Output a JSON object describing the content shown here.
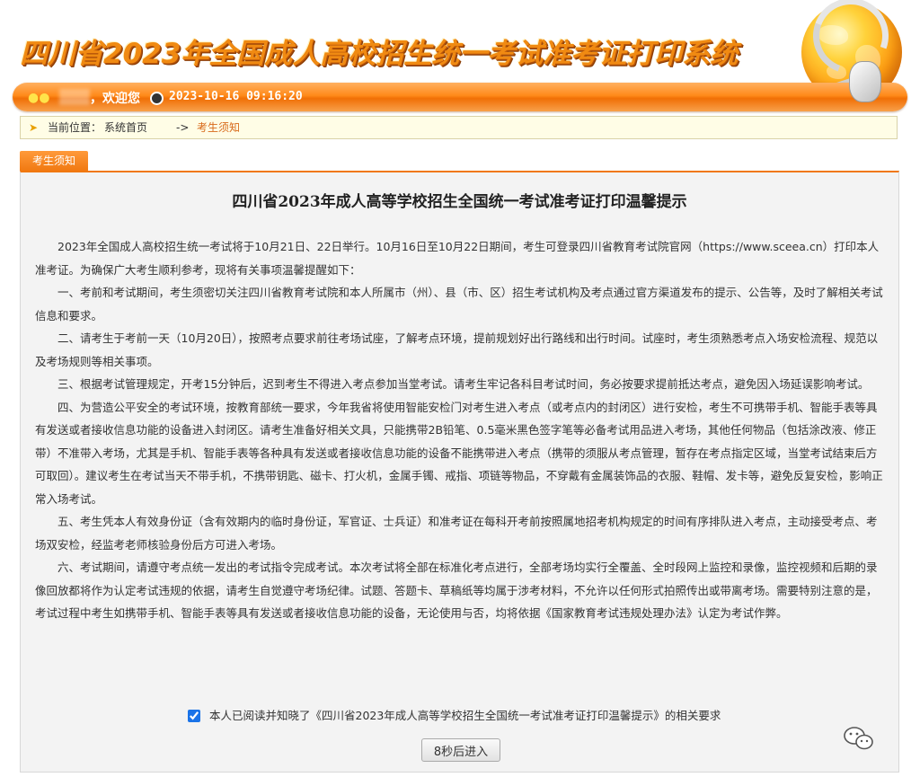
{
  "header": {
    "site_title": "四川省2023年全国成人高校招生统一考试准考证打印系统",
    "welcome": "，欢迎您",
    "datetime": "2023-10-16 09:16:20"
  },
  "breadcrumb": {
    "label": "当前位置：",
    "home": "系统首页",
    "separator": "->",
    "current": "考生须知"
  },
  "tab": {
    "label": "考生须知"
  },
  "notice": {
    "title": "四川省2023年成人高等学校招生全国统一考试准考证打印温馨提示",
    "paragraphs": [
      "2023年全国成人高校招生统一考试将于10月21日、22日举行。10月16日至10月22日期间，考生可登录四川省教育考试院官网（https://www.sceea.cn）打印本人准考证。为确保广大考生顺利参考，现将有关事项温馨提醒如下：",
      "一、考前和考试期间，考生须密切关注四川省教育考试院和本人所属市（州）、县（市、区）招生考试机构及考点通过官方渠道发布的提示、公告等，及时了解相关考试信息和要求。",
      "二、请考生于考前一天（10月20日），按照考点要求前往考场试座，了解考点环境，提前规划好出行路线和出行时间。试座时，考生须熟悉考点入场安检流程、规范以及考场规则等相关事项。",
      "三、根据考试管理规定，开考15分钟后，迟到考生不得进入考点参加当堂考试。请考生牢记各科目考试时间，务必按要求提前抵达考点，避免因入场延误影响考试。",
      "四、为营造公平安全的考试环境，按教育部统一要求，今年我省将使用智能安检门对考生进入考点（或考点内的封闭区）进行安检，考生不可携带手机、智能手表等具有发送或者接收信息功能的设备进入封闭区。请考生准备好相关文具，只能携带2B铅笔、0.5毫米黑色签字笔等必备考试用品进入考场，其他任何物品（包括涂改液、修正带）不准带入考场，尤其是手机、智能手表等各种具有发送或者接收信息功能的设备不能携带进入考点（携带的须服从考点管理，暂存在考点指定区域，当堂考试结束后方可取回）。建议考生在考试当天不带手机，不携带钥匙、磁卡、打火机，金属手镯、戒指、项链等物品，不穿戴有金属装饰品的衣服、鞋帽、发卡等，避免反复安检，影响正常入场考试。",
      "五、考生凭本人有效身份证（含有效期内的临时身份证，军官证、士兵证）和准考证在每科开考前按照属地招考机构规定的时间有序排队进入考点，主动接受考点、考场双安检，经监考老师核验身份后方可进入考场。",
      "六、考试期间，请遵守考点统一发出的考试指令完成考试。本次考试将全部在标准化考点进行，全部考场均实行全覆盖、全时段网上监控和录像，监控视频和后期的录像回放都将作为认定考试违规的依据，请考生自觉遵守考场纪律。试题、答题卡、草稿纸等均属于涉考材料，不允许以任何形式拍照传出或带离考场。需要特别注意的是，考试过程中考生如携带手机、智能手表等具有发送或者接收信息功能的设备，无论使用与否，均将依据《国家教育考试违规处理办法》认定为考试作弊。"
    ]
  },
  "agreement": {
    "checked": true,
    "label": "本人已阅读并知晓了《四川省2023年成人高等学校招生全国统一考试准考证打印温馨提示》的相关要求"
  },
  "enter_button": {
    "label": "8秒后进入"
  },
  "icons": {
    "user": "users-icon",
    "clock": "clock-icon",
    "arrow": "arrow-right-icon",
    "wechat": "wechat-icon"
  },
  "colors": {
    "accent": "#f07810",
    "title": "#f08a12",
    "breadcrumb_current": "#d86a1a",
    "panel_bg": "#f3f3f3"
  }
}
